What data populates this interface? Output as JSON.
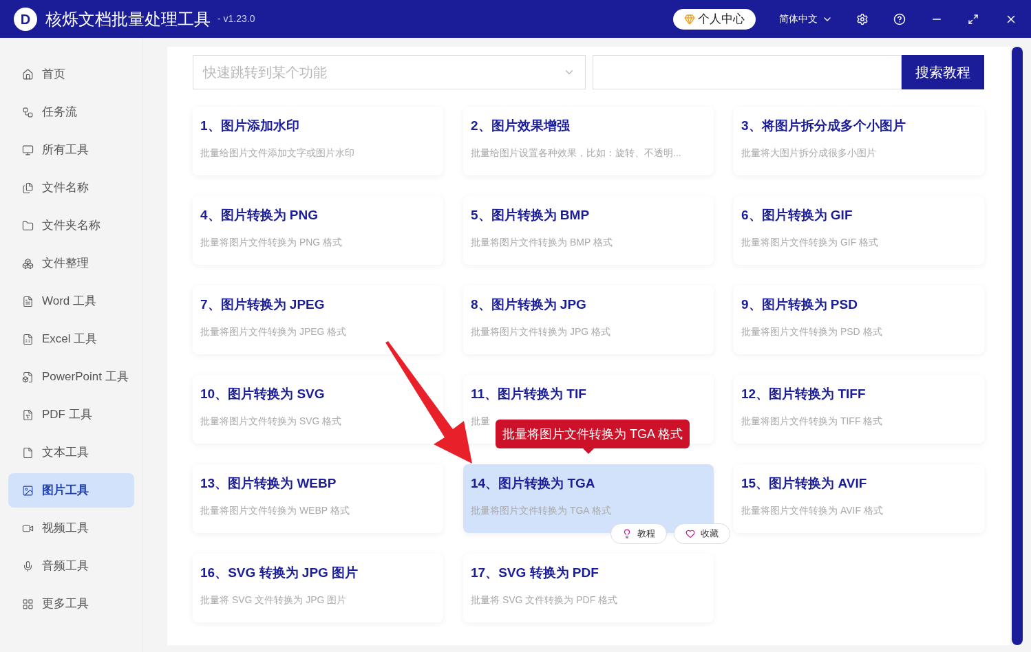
{
  "window": {
    "title": "核烁文档批量处理工具",
    "version": "- v1.23.0",
    "logo": "D"
  },
  "header": {
    "user_center": "个人中心",
    "language": "简体中文"
  },
  "sidebar": {
    "items": [
      {
        "label": "首页",
        "selected": false
      },
      {
        "label": "任务流",
        "selected": false
      },
      {
        "label": "所有工具",
        "selected": false
      },
      {
        "label": "文件名称",
        "selected": false
      },
      {
        "label": "文件夹名称",
        "selected": false
      },
      {
        "label": "文件整理",
        "selected": false
      },
      {
        "label": "Word 工具",
        "selected": false
      },
      {
        "label": "Excel 工具",
        "selected": false
      },
      {
        "label": "PowerPoint 工具",
        "selected": false
      },
      {
        "label": "PDF 工具",
        "selected": false
      },
      {
        "label": "文本工具",
        "selected": false
      },
      {
        "label": "图片工具",
        "selected": true
      },
      {
        "label": "视频工具",
        "selected": false
      },
      {
        "label": "音频工具",
        "selected": false
      },
      {
        "label": "更多工具",
        "selected": false
      }
    ]
  },
  "search": {
    "placeholder": "快速跳转到某个功能",
    "button": "搜索教程"
  },
  "cards": [
    {
      "title": "1、图片添加水印",
      "desc": "批量给图片文件添加文字或图片水印",
      "selected": false
    },
    {
      "title": "2、图片效果增强",
      "desc": "批量给图片设置各种效果，比如：旋转、不透明...",
      "selected": false
    },
    {
      "title": "3、将图片拆分成多个小图片",
      "desc": "批量将大图片拆分成很多小图片",
      "selected": false
    },
    {
      "title": "4、图片转换为 PNG",
      "desc": "批量将图片文件转换为 PNG 格式",
      "selected": false
    },
    {
      "title": "5、图片转换为 BMP",
      "desc": "批量将图片文件转换为 BMP 格式",
      "selected": false
    },
    {
      "title": "6、图片转换为 GIF",
      "desc": "批量将图片文件转换为 GIF 格式",
      "selected": false
    },
    {
      "title": "7、图片转换为 JPEG",
      "desc": "批量将图片文件转换为 JPEG 格式",
      "selected": false
    },
    {
      "title": "8、图片转换为 JPG",
      "desc": "批量将图片文件转换为 JPG 格式",
      "selected": false
    },
    {
      "title": "9、图片转换为 PSD",
      "desc": "批量将图片文件转换为 PSD 格式",
      "selected": false
    },
    {
      "title": "10、图片转换为 SVG",
      "desc": "批量将图片文件转换为 SVG 格式",
      "selected": false
    },
    {
      "title": "11、图片转换为 TIF",
      "desc": "批量",
      "selected": false
    },
    {
      "title": "12、图片转换为 TIFF",
      "desc": "批量将图片文件转换为 TIFF 格式",
      "selected": false
    },
    {
      "title": "13、图片转换为 WEBP",
      "desc": "批量将图片文件转换为 WEBP 格式",
      "selected": false
    },
    {
      "title": "14、图片转换为 TGA",
      "desc": "批量将图片文件转换为 TGA 格式",
      "selected": true
    },
    {
      "title": "15、图片转换为 AVIF",
      "desc": "批量将图片文件转换为 AVIF 格式",
      "selected": false
    },
    {
      "title": "16、SVG 转换为 JPG 图片",
      "desc": "批量将 SVG 文件转换为 JPG 图片",
      "selected": false
    },
    {
      "title": "17、SVG 转换为 PDF",
      "desc": "批量将 SVG 文件转换为 PDF 格式",
      "selected": false
    }
  ],
  "hover_tooltip": "批量将图片文件转换为 TGA 格式",
  "hover_actions": [
    "教程",
    "收藏"
  ]
}
